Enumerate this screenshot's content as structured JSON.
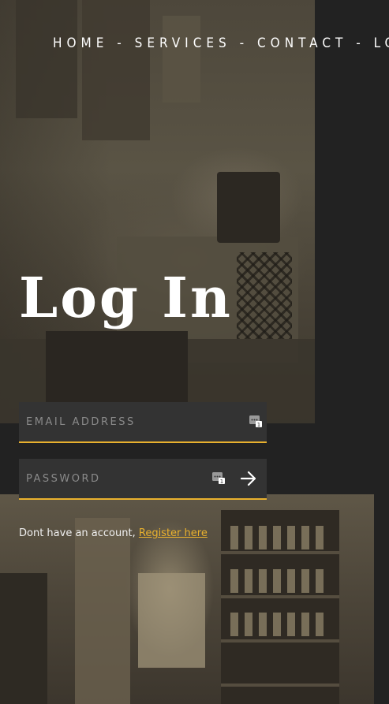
{
  "nav": {
    "items": [
      {
        "label": "HOME"
      },
      {
        "label": "SERVICES"
      },
      {
        "label": "CONTACT"
      },
      {
        "label": "LOGIN"
      }
    ],
    "separator": "-"
  },
  "page_title": "Log In",
  "form": {
    "email": {
      "placeholder": "EMAIL ADDRESS",
      "value": ""
    },
    "password": {
      "placeholder": "PASSWORD",
      "value": ""
    }
  },
  "register": {
    "prompt": "Dont have an account,",
    "link_label": "Register here"
  },
  "icons": {
    "password_manager": "password-manager-icon",
    "submit": "arrow-right-icon"
  },
  "colors": {
    "accent": "#e9b12e",
    "background": "#222222",
    "field_background": "#333333"
  }
}
